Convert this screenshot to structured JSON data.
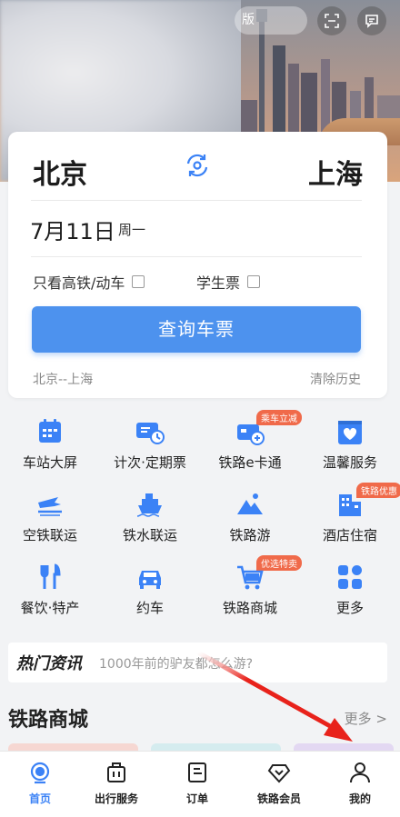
{
  "hero": {
    "pill_text": "版",
    "scan_icon": "scan-icon",
    "message_icon": "message-icon"
  },
  "search": {
    "from_city": "北京",
    "to_city": "上海",
    "date": "7月11日",
    "weekday": "周一",
    "option_fast": "只看高铁/动车",
    "option_student": "学生票",
    "search_button": "查询车票",
    "history_route": "北京--上海",
    "clear_history": "清除历史"
  },
  "services": [
    {
      "label": "车站大屏",
      "icon": "station-screen-icon"
    },
    {
      "label": "计次·定期票",
      "icon": "period-ticket-icon"
    },
    {
      "label": "铁路e卡通",
      "icon": "e-card-icon",
      "badge": "乘车立减"
    },
    {
      "label": "温馨服务",
      "icon": "care-service-icon"
    },
    {
      "label": "空铁联运",
      "icon": "air-rail-icon"
    },
    {
      "label": "铁水联运",
      "icon": "rail-ship-icon"
    },
    {
      "label": "铁路游",
      "icon": "rail-travel-icon"
    },
    {
      "label": "酒店住宿",
      "icon": "hotel-icon",
      "badge": "铁路优惠"
    },
    {
      "label": "餐饮·特产",
      "icon": "food-icon"
    },
    {
      "label": "约车",
      "icon": "car-icon"
    },
    {
      "label": "铁路商城",
      "icon": "shopping-cart-icon",
      "badge": "优选特卖"
    },
    {
      "label": "更多",
      "icon": "more-grid-icon"
    }
  ],
  "hot_news": {
    "title": "热门资讯",
    "text": "1000年前的驴友都怎么游?"
  },
  "mall": {
    "title": "铁路商城",
    "more": "更多 >"
  },
  "tabbar": {
    "items": [
      {
        "label": "首页",
        "icon": "home-icon",
        "active": true
      },
      {
        "label": "出行服务",
        "icon": "travel-service-icon"
      },
      {
        "label": "订单",
        "icon": "order-icon"
      },
      {
        "label": "铁路会员",
        "icon": "member-diamond-icon"
      },
      {
        "label": "我的",
        "icon": "profile-icon"
      }
    ]
  },
  "colors": {
    "accent": "#4d92ee",
    "badge": "#f06a4a",
    "annotation_arrow": "#e8221b"
  }
}
